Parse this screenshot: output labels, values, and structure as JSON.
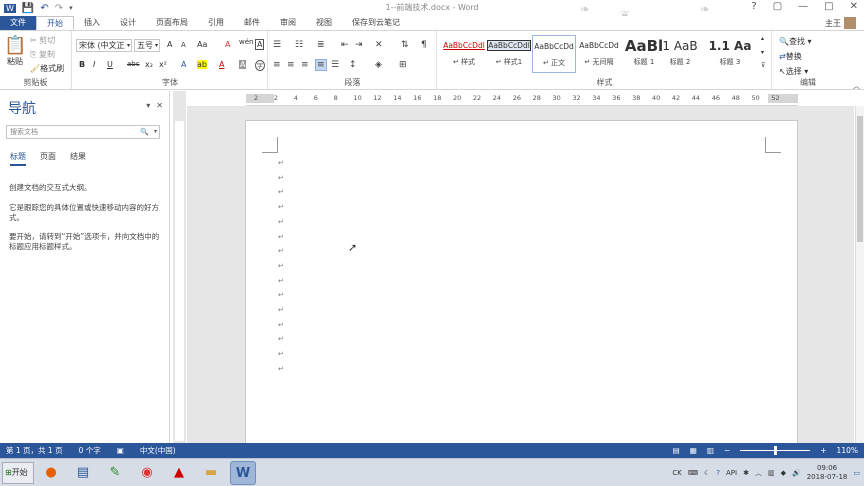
{
  "window": {
    "title": "1--前端技术.docx - Word",
    "controls": {
      "help": "?",
      "restore": "▢",
      "minimize": "—",
      "maximize": "□",
      "close": "✕"
    }
  },
  "qat": {
    "save": "💾",
    "undo": "↶",
    "redo": "↷",
    "customize": "▾"
  },
  "tabs": [
    "文件",
    "开始",
    "插入",
    "设计",
    "页面布局",
    "引用",
    "邮件",
    "审阅",
    "视图",
    "保存到云笔记"
  ],
  "active_tab": "开始",
  "user": {
    "name": "主王"
  },
  "ribbon": {
    "clipboard": {
      "label": "剪贴板",
      "paste": "粘贴",
      "cut": "剪切",
      "copy": "复制",
      "format_painter": "格式刷"
    },
    "font": {
      "label": "字体",
      "font_name": "宋体 (中文正",
      "font_size": "五号",
      "bold": "B",
      "italic": "I",
      "underline": "U",
      "strike": "abc",
      "subscript": "x₂",
      "superscript": "x²",
      "grow": "A",
      "shrink": "A",
      "case": "Aa",
      "clear": "A",
      "phonetic": "wén",
      "border_char": "A",
      "font_color": "A",
      "highlight": "ab",
      "shade": "A",
      "encircle": "字"
    },
    "paragraph": {
      "label": "段落"
    },
    "styles": {
      "label": "样式",
      "items": [
        {
          "preview": "AaBbCcDdl",
          "name": "↵ 样式"
        },
        {
          "preview": "AaBbCcDdl",
          "name": "↵ 样式1"
        },
        {
          "preview": "AaBbCcDd",
          "name": "↵ 正文"
        },
        {
          "preview": "AaBbCcDd",
          "name": "↵ 无间隔"
        },
        {
          "preview": "AaBl",
          "name": "标题 1"
        },
        {
          "preview": "1",
          "name": "标题 2"
        },
        {
          "preview": "AaB",
          "name": "标题 2"
        },
        {
          "preview": "1.1",
          "name": "标题 3"
        },
        {
          "preview": "Aa",
          "name": "标题 3"
        }
      ]
    },
    "editing": {
      "label": "编辑",
      "find": "查找",
      "replace": "替换",
      "select": "选择"
    }
  },
  "nav": {
    "title": "导航",
    "search_placeholder": "搜索文档",
    "tabs": [
      "标题",
      "页面",
      "结果"
    ],
    "text1": "创建文档的交互式大纲。",
    "text2": "它是跟踪您的具体位置或快速移动内容的好方式。",
    "text3": "要开始，请转到“开始”选项卡，并向文档中的标题应用标题样式。"
  },
  "ruler": {
    "numbers": [
      "2",
      "2",
      "4",
      "6",
      "8",
      "10",
      "12",
      "14",
      "16",
      "18",
      "20",
      "22",
      "24",
      "26",
      "28",
      "30",
      "32",
      "34",
      "36",
      "38",
      "40",
      "42",
      "44",
      "46",
      "48",
      "50",
      "52"
    ]
  },
  "document": {
    "paragraph_marks": [
      "↵",
      "↵",
      "↵",
      "↵",
      "↵",
      "↵",
      "↵",
      "↵",
      "↵",
      "↵",
      "↵",
      "↵",
      "↵",
      "↵",
      "↵"
    ]
  },
  "statusbar": {
    "page": "第 1 页，共 1 页",
    "words": "0 个字",
    "language": "中文(中国)",
    "zoom": "110%",
    "zoom_minus": "−",
    "zoom_plus": "+"
  },
  "taskbar": {
    "start": "开始",
    "ime": "CK",
    "clock_time": "09:06",
    "clock_date": "2018-07-18",
    "tray_text": "API"
  },
  "colors": {
    "accent": "#2b579a"
  }
}
